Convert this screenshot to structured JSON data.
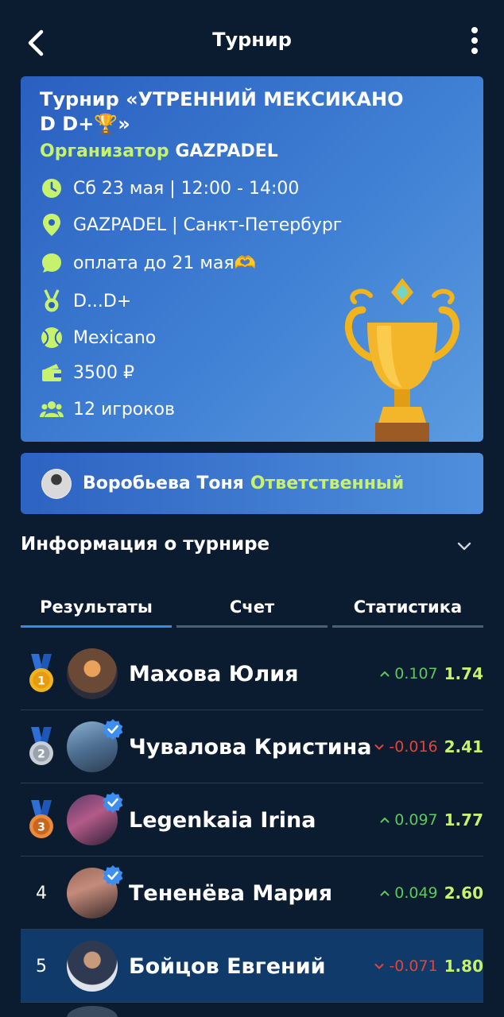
{
  "header": {
    "title": "Турнир",
    "back_icon": "chevron-left-icon",
    "more_icon": "more-vertical-icon"
  },
  "tournament": {
    "title": "Турнир «УТРЕННИЙ МЕКСИКАНО D D+🏆»",
    "organizer_label": "Организатор",
    "organizer_name": "GAZPADEL",
    "date": "Сб 23 мая | 12:00 - 14:00",
    "location": "GAZPADEL | Санкт-Петербург",
    "comment": "оплата до 21 мая🫶",
    "level": "D...D+",
    "format": "Mexicano",
    "price": "3500 ₽",
    "players": "12 игроков"
  },
  "responsible": {
    "name": "Воробьева Тоня",
    "role": "Ответственный"
  },
  "info": {
    "title": "Информация о турнире"
  },
  "tabs": [
    {
      "label": "Результаты",
      "active": true
    },
    {
      "label": "Счет",
      "active": false
    },
    {
      "label": "Статистика",
      "active": false
    }
  ],
  "results": [
    {
      "rank": "1",
      "medal": "gold",
      "name": "Махова Юлия",
      "verified": false,
      "trend": "up",
      "delta": "0.107",
      "rating": "1.74"
    },
    {
      "rank": "2",
      "medal": "silver",
      "name": "Чувалова Кристина",
      "verified": true,
      "trend": "down",
      "delta": "-0.016",
      "rating": "2.41"
    },
    {
      "rank": "3",
      "medal": "bronze",
      "name": "Legenkaia Irina",
      "verified": true,
      "trend": "up",
      "delta": "0.097",
      "rating": "1.77"
    },
    {
      "rank": "4",
      "medal": "",
      "name": "Тененёва Мария",
      "verified": true,
      "trend": "up",
      "delta": "0.049",
      "rating": "2.60"
    },
    {
      "rank": "5",
      "medal": "",
      "name": "Бойцов Евгений",
      "verified": false,
      "trend": "down",
      "delta": "-0.071",
      "rating": "1.80",
      "highlight": true
    }
  ],
  "colors": {
    "accent_green": "#c6f26e",
    "up": "#5cc85c",
    "down": "#e2443a",
    "tab_active": "#2d8cf0"
  }
}
